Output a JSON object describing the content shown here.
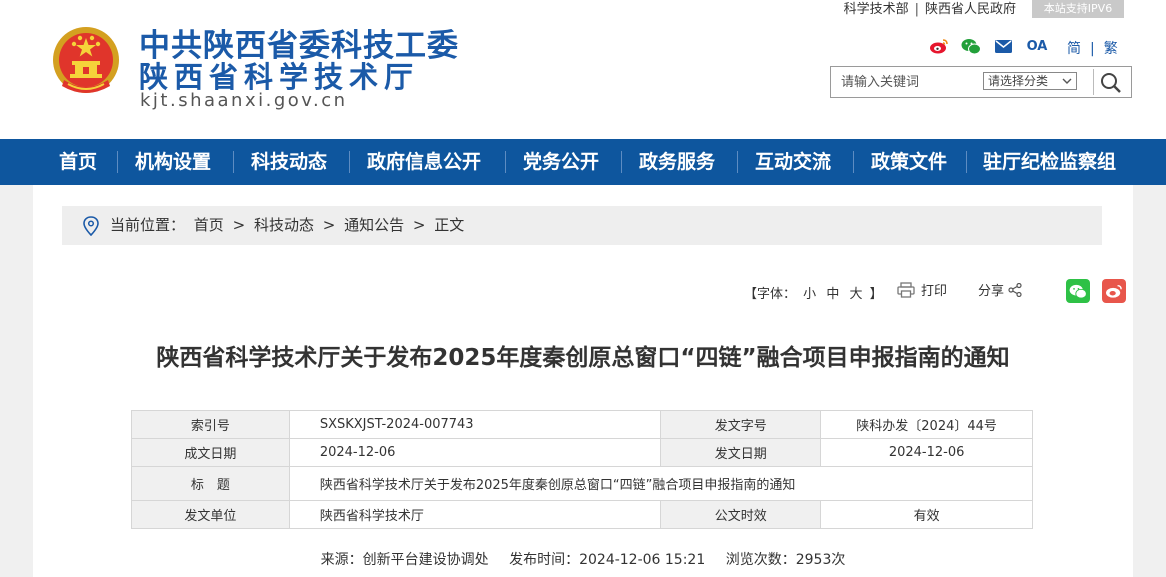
{
  "header": {
    "title_line1": "中共陕西省委科技工委",
    "title_line2": "陕西省科学技术厅",
    "domain": "kjt.shaanxi.gov.cn",
    "top_links": [
      "科学技术部",
      "陕西省人民政府"
    ],
    "ipv6_badge": "本站支持IPV6",
    "social_icons": [
      "weibo-icon",
      "wechat-icon",
      "mail-icon",
      "oa-icon"
    ],
    "oa_label": "OA",
    "lang_simplified": "简",
    "lang_traditional": "繁",
    "search_placeholder": "请输入关键词",
    "category_select": "请选择分类"
  },
  "nav": {
    "items": [
      "首页",
      "机构设置",
      "科技动态",
      "政府信息公开",
      "党务公开",
      "政务服务",
      "互动交流",
      "政策文件",
      "驻厅纪检监察组"
    ]
  },
  "breadcrumb": {
    "prefix": "当前位置：",
    "items": [
      "首页",
      "科技动态",
      "通知公告",
      "正文"
    ],
    "sep": ">"
  },
  "tools": {
    "font_label_open": "【字体：",
    "font_small": "小",
    "font_medium": "中",
    "font_large": "大",
    "font_label_close": "】",
    "print": "打印",
    "share": "分享"
  },
  "article": {
    "title": "陕西省科学技术厅关于发布2025年度秦创原总窗口“四链”融合项目申报指南的通知",
    "meta": {
      "index_no_label": "索引号",
      "index_no": "SXSKXJST-2024-007743",
      "doc_no_label": "发文字号",
      "doc_no": "陕科办发〔2024〕44号",
      "written_date_label": "成文日期",
      "written_date": "2024-12-06",
      "issue_date_label": "发文日期",
      "issue_date": "2024-12-06",
      "title_label": "标　题",
      "title_value": "陕西省科学技术厅关于发布2025年度秦创原总窗口“四链”融合项目申报指南的通知",
      "issuer_label": "发文单位",
      "issuer": "陕西省科学技术厅",
      "validity_label": "公文时效",
      "validity": "有效"
    },
    "source_line": {
      "source": "来源：创新平台建设协调处",
      "publish": "发布时间：2024-12-06 15:21",
      "views": "浏览次数：2953次"
    }
  },
  "colors": {
    "brand_blue": "#1b5aa8",
    "nav_bg": "#0e569e",
    "wechat_green": "#2ec146",
    "weibo_red": "#e8564b"
  }
}
